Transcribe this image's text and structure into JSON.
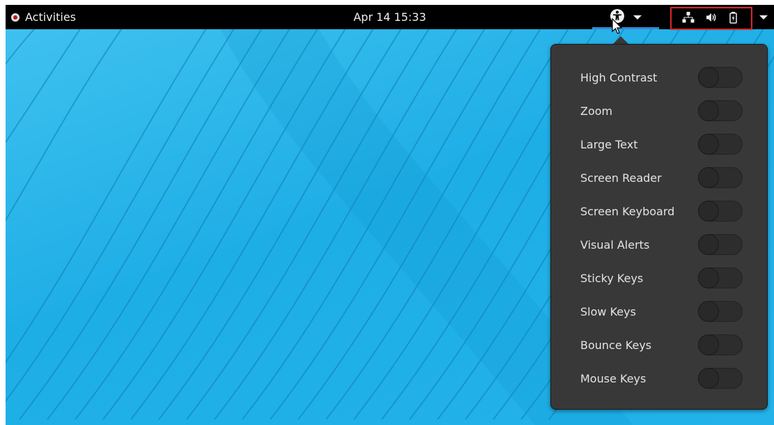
{
  "topbar": {
    "activities_label": "Activities",
    "clock": "Apr 14 15:33",
    "accessibility_icon": "accessibility-icon",
    "status_icons": [
      "network-wired-icon",
      "volume-icon",
      "battery-charging-icon"
    ]
  },
  "accessibility_menu": {
    "items": [
      {
        "label": "High Contrast",
        "enabled": false
      },
      {
        "label": "Zoom",
        "enabled": false
      },
      {
        "label": "Large Text",
        "enabled": false
      },
      {
        "label": "Screen Reader",
        "enabled": false
      },
      {
        "label": "Screen Keyboard",
        "enabled": false
      },
      {
        "label": "Visual Alerts",
        "enabled": false
      },
      {
        "label": "Sticky Keys",
        "enabled": false
      },
      {
        "label": "Slow Keys",
        "enabled": false
      },
      {
        "label": "Bounce Keys",
        "enabled": false
      },
      {
        "label": "Mouse Keys",
        "enabled": false
      }
    ]
  },
  "colors": {
    "topbar_bg": "#000000",
    "menu_bg": "#383838",
    "desktop_blue": "#1eaee6",
    "highlight_box": "#e3232a",
    "active_underline": "#3a86d4"
  }
}
